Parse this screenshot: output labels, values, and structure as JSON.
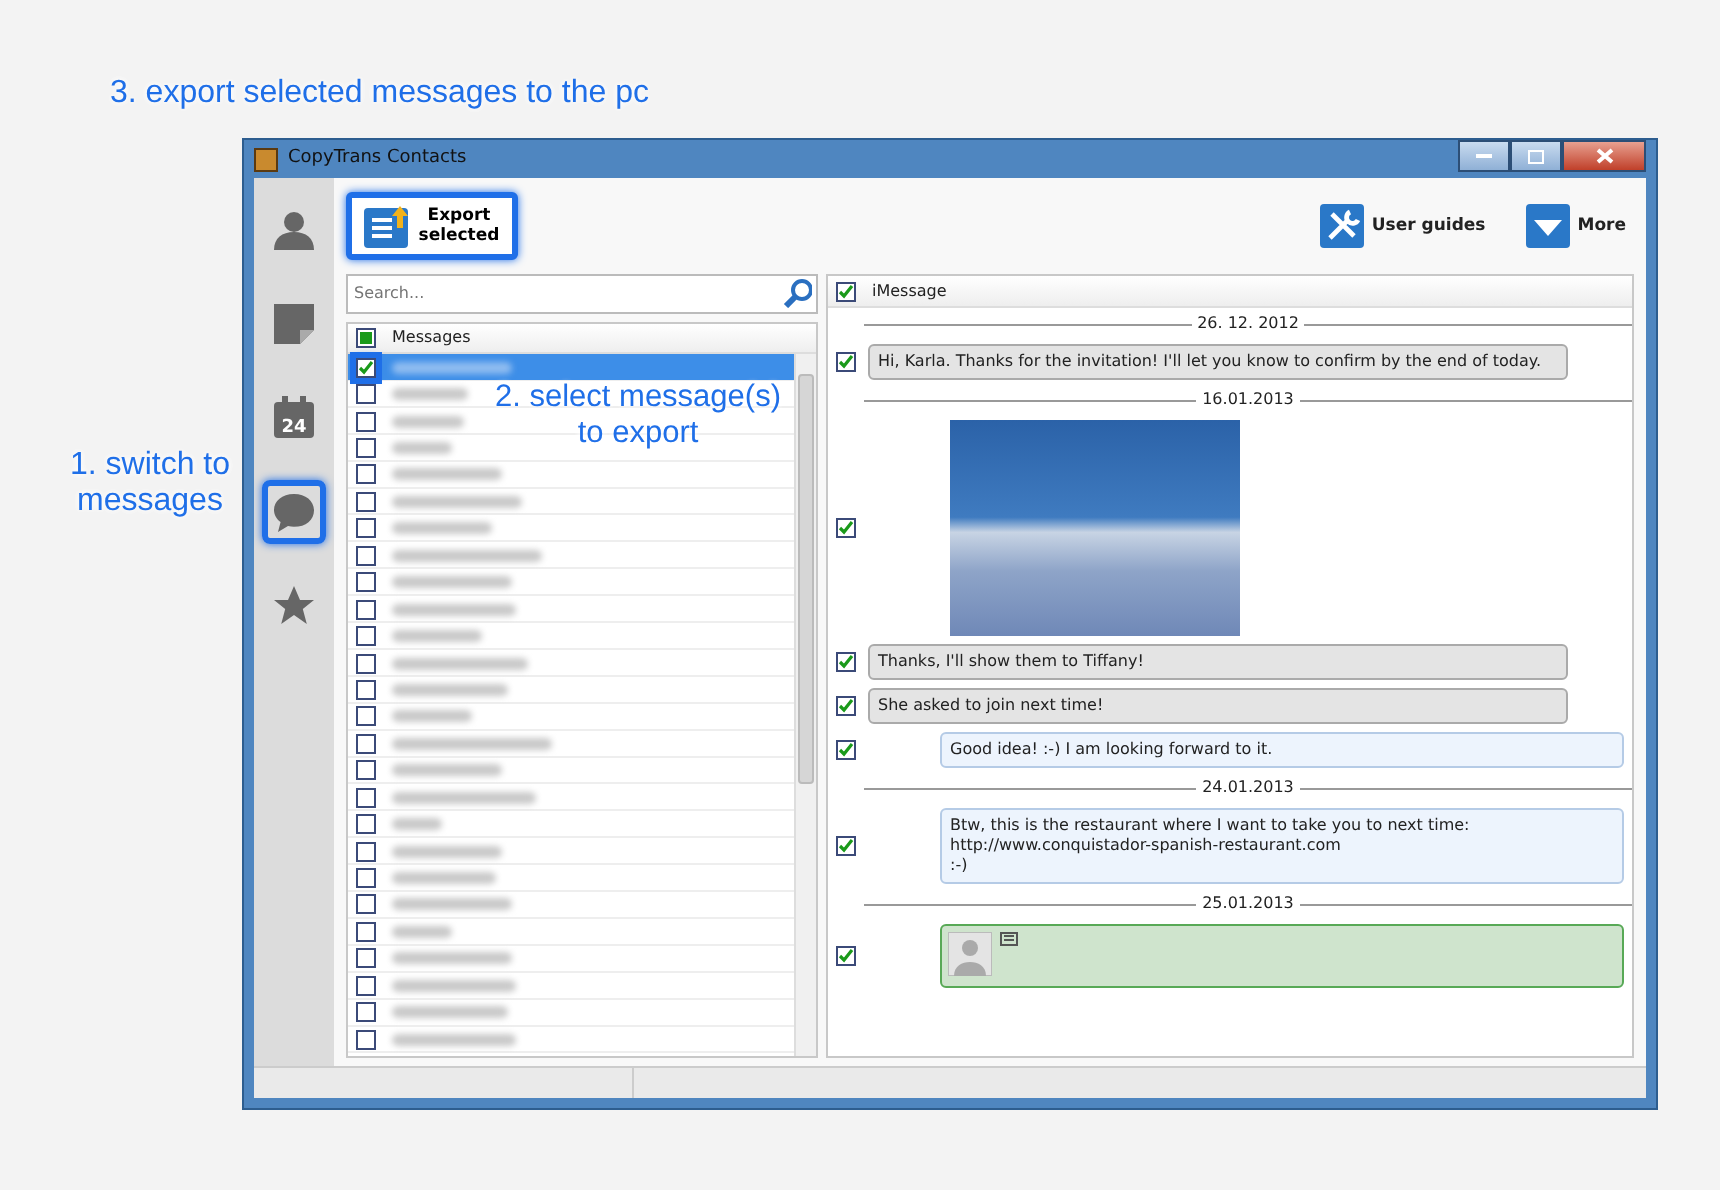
{
  "annotations": [
    {
      "kind": "heading",
      "text": "3. export selected messages to the pc"
    },
    {
      "kind": "side",
      "text": "1. switch to messages"
    },
    {
      "kind": "list",
      "text": "2. select message(s) to export"
    }
  ],
  "window": {
    "title": "CopyTrans Contacts"
  },
  "sidebar": {
    "items": [
      {
        "kind": "contacts",
        "highlighted": false
      },
      {
        "kind": "notes",
        "highlighted": false
      },
      {
        "kind": "calendar",
        "label": "24",
        "highlighted": false
      },
      {
        "kind": "messages",
        "highlighted": true
      },
      {
        "kind": "favorites",
        "highlighted": false
      }
    ]
  },
  "toolbar": {
    "export": {
      "label": "Export selected",
      "highlighted": true
    },
    "user_guides": "User guides",
    "more": "More"
  },
  "search": {
    "placeholder": "Search..."
  },
  "conversations": {
    "header": "Messages",
    "header_partial": true,
    "rows": [
      {
        "checked": true,
        "selected": true,
        "highlighted": true
      },
      {
        "checked": false,
        "selected": false,
        "highlighted": false
      },
      {
        "checked": false,
        "selected": false,
        "highlighted": false
      },
      {
        "checked": false,
        "selected": false,
        "highlighted": false
      },
      {
        "checked": false,
        "selected": false,
        "highlighted": false
      },
      {
        "checked": false,
        "selected": false,
        "highlighted": false
      },
      {
        "checked": false,
        "selected": false,
        "highlighted": false
      },
      {
        "checked": false,
        "selected": false,
        "highlighted": false
      },
      {
        "checked": false,
        "selected": false,
        "highlighted": false
      },
      {
        "checked": false,
        "selected": false,
        "highlighted": false
      },
      {
        "checked": false,
        "selected": false,
        "highlighted": false
      },
      {
        "checked": false,
        "selected": false,
        "highlighted": false
      },
      {
        "checked": false,
        "selected": false,
        "highlighted": false
      },
      {
        "checked": false,
        "selected": false,
        "highlighted": false
      },
      {
        "checked": false,
        "selected": false,
        "highlighted": false
      },
      {
        "checked": false,
        "selected": false,
        "highlighted": false
      },
      {
        "checked": false,
        "selected": false,
        "highlighted": false
      },
      {
        "checked": false,
        "selected": false,
        "highlighted": false
      },
      {
        "checked": false,
        "selected": false,
        "highlighted": false
      },
      {
        "checked": false,
        "selected": false,
        "highlighted": false
      },
      {
        "checked": false,
        "selected": false,
        "highlighted": false
      },
      {
        "checked": false,
        "selected": false,
        "highlighted": false
      },
      {
        "checked": false,
        "selected": false,
        "highlighted": false
      },
      {
        "checked": false,
        "selected": false,
        "highlighted": false
      },
      {
        "checked": false,
        "selected": false,
        "highlighted": false
      },
      {
        "checked": false,
        "selected": false,
        "highlighted": false
      }
    ]
  },
  "messages": {
    "header": "iMessage",
    "header_checked": true,
    "items": [
      {
        "kind": "date",
        "text": "26. 12. 2012"
      },
      {
        "kind": "received",
        "checked": true,
        "text": "Hi, Karla. Thanks for the invitation! I'll let you know to confirm by the end of today."
      },
      {
        "kind": "date",
        "text": "16.01.2013"
      },
      {
        "kind": "photo",
        "checked": true
      },
      {
        "kind": "received",
        "checked": true,
        "text": "Thanks, I'll show them to Tiffany!"
      },
      {
        "kind": "received",
        "checked": true,
        "text": "She asked to join next time!"
      },
      {
        "kind": "sent",
        "checked": true,
        "text": "Good idea! :-) I am looking forward to it."
      },
      {
        "kind": "date",
        "text": "24.01.2013"
      },
      {
        "kind": "sent",
        "checked": true,
        "text": "Btw, this is the restaurant where I want to take you to next time:\nhttp://www.conquistador-spanish-restaurant.com\n:-)"
      },
      {
        "kind": "date",
        "text": "25.01.2013"
      },
      {
        "kind": "contact",
        "checked": true
      }
    ]
  }
}
